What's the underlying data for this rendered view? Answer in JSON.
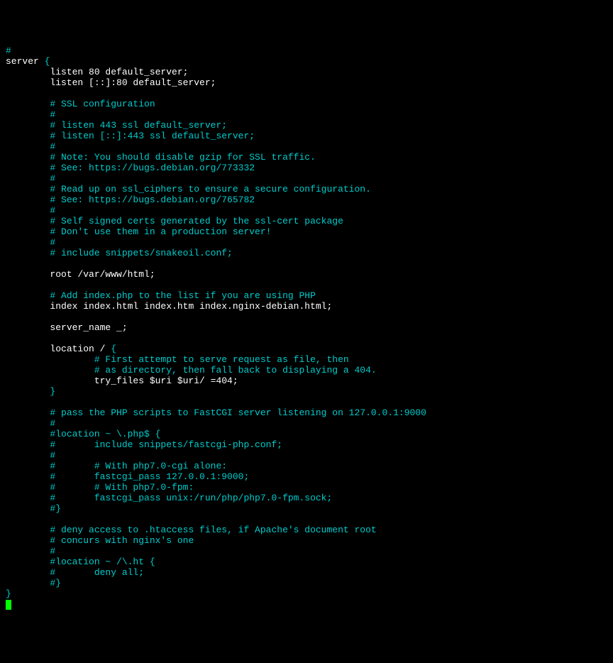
{
  "lines": [
    {
      "cls": "c",
      "text": "#"
    },
    {
      "segs": [
        {
          "cls": "w",
          "text": "server "
        },
        {
          "cls": "c",
          "text": "{"
        }
      ]
    },
    {
      "cls": "w",
      "text": "        listen 80 default_server;"
    },
    {
      "cls": "w",
      "text": "        listen [::]:80 default_server;"
    },
    {
      "cls": "w",
      "text": ""
    },
    {
      "cls": "c",
      "text": "        # SSL configuration"
    },
    {
      "cls": "c",
      "text": "        #"
    },
    {
      "cls": "c",
      "text": "        # listen 443 ssl default_server;"
    },
    {
      "cls": "c",
      "text": "        # listen [::]:443 ssl default_server;"
    },
    {
      "cls": "c",
      "text": "        #"
    },
    {
      "cls": "c",
      "text": "        # Note: You should disable gzip for SSL traffic."
    },
    {
      "cls": "c",
      "text": "        # See: https://bugs.debian.org/773332"
    },
    {
      "cls": "c",
      "text": "        #"
    },
    {
      "cls": "c",
      "text": "        # Read up on ssl_ciphers to ensure a secure configuration."
    },
    {
      "cls": "c",
      "text": "        # See: https://bugs.debian.org/765782"
    },
    {
      "cls": "c",
      "text": "        #"
    },
    {
      "cls": "c",
      "text": "        # Self signed certs generated by the ssl-cert package"
    },
    {
      "cls": "c",
      "text": "        # Don't use them in a production server!"
    },
    {
      "cls": "c",
      "text": "        #"
    },
    {
      "cls": "c",
      "text": "        # include snippets/snakeoil.conf;"
    },
    {
      "cls": "w",
      "text": ""
    },
    {
      "cls": "w",
      "text": "        root /var/www/html;"
    },
    {
      "cls": "w",
      "text": ""
    },
    {
      "cls": "c",
      "text": "        # Add index.php to the list if you are using PHP"
    },
    {
      "cls": "w",
      "text": "        index index.html index.htm index.nginx-debian.html;"
    },
    {
      "cls": "w",
      "text": ""
    },
    {
      "cls": "w",
      "text": "        server_name _;"
    },
    {
      "cls": "w",
      "text": ""
    },
    {
      "segs": [
        {
          "cls": "w",
          "text": "        location / "
        },
        {
          "cls": "c",
          "text": "{"
        }
      ]
    },
    {
      "cls": "c",
      "text": "                # First attempt to serve request as file, then"
    },
    {
      "cls": "c",
      "text": "                # as directory, then fall back to displaying a 404."
    },
    {
      "cls": "w",
      "text": "                try_files $uri $uri/ =404;"
    },
    {
      "cls": "c",
      "text": "        }"
    },
    {
      "cls": "w",
      "text": ""
    },
    {
      "cls": "c",
      "text": "        # pass the PHP scripts to FastCGI server listening on 127.0.0.1:9000"
    },
    {
      "cls": "c",
      "text": "        #"
    },
    {
      "cls": "c",
      "text": "        #location ~ \\.php$ {"
    },
    {
      "cls": "c",
      "text": "        #       include snippets/fastcgi-php.conf;"
    },
    {
      "cls": "c",
      "text": "        #"
    },
    {
      "cls": "c",
      "text": "        #       # With php7.0-cgi alone:"
    },
    {
      "cls": "c",
      "text": "        #       fastcgi_pass 127.0.0.1:9000;"
    },
    {
      "cls": "c",
      "text": "        #       # With php7.0-fpm:"
    },
    {
      "cls": "c",
      "text": "        #       fastcgi_pass unix:/run/php/php7.0-fpm.sock;"
    },
    {
      "cls": "c",
      "text": "        #}"
    },
    {
      "cls": "w",
      "text": ""
    },
    {
      "cls": "c",
      "text": "        # deny access to .htaccess files, if Apache's document root"
    },
    {
      "cls": "c",
      "text": "        # concurs with nginx's one"
    },
    {
      "cls": "c",
      "text": "        #"
    },
    {
      "cls": "c",
      "text": "        #location ~ /\\.ht {"
    },
    {
      "cls": "c",
      "text": "        #       deny all;"
    },
    {
      "cls": "c",
      "text": "        #}"
    },
    {
      "cls": "c",
      "text": "}"
    }
  ]
}
